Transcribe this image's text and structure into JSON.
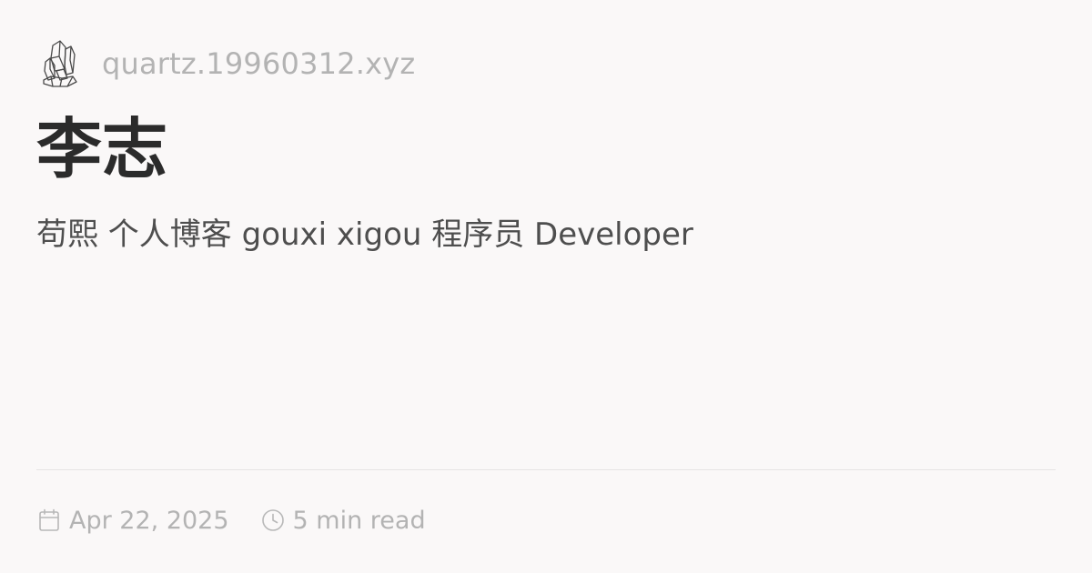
{
  "header": {
    "logo_icon": "crystal-quartz-icon",
    "site_name": "quartz.19960312.xyz"
  },
  "page": {
    "title": "李志",
    "description": "苟熙 个人博客 gouxi xigou 程序员 Developer"
  },
  "meta": {
    "date_icon": "calendar-icon",
    "date": "Apr 22, 2025",
    "read_icon": "clock-icon",
    "read_time": "5 min read"
  },
  "colors": {
    "background": "#faf8f8",
    "title": "#2b2b2b",
    "description": "#4e4e4e",
    "muted": "#b3b3b3",
    "divider": "#e6e4e4"
  }
}
